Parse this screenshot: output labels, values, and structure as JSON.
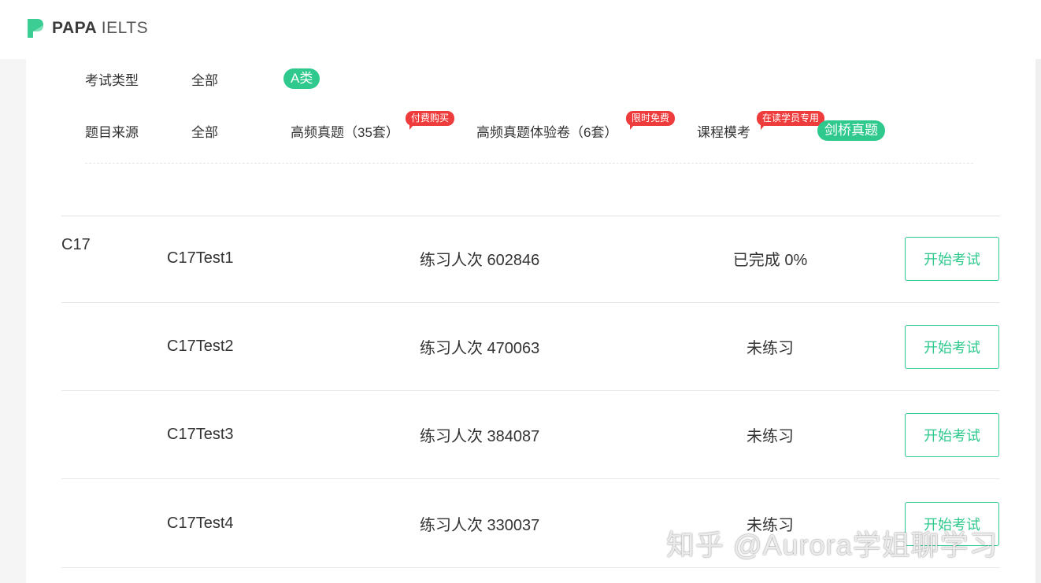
{
  "brand": {
    "name_bold": "PAPA",
    "name_light": "IELTS",
    "accent": "#2fc98e"
  },
  "filters": {
    "exam_type": {
      "label": "考试类型",
      "options": [
        {
          "label": "全部",
          "selected": false
        },
        {
          "label": "A类",
          "selected": true
        }
      ]
    },
    "source": {
      "label": "题目来源",
      "options": [
        {
          "label": "全部",
          "selected": false,
          "badge": ""
        },
        {
          "label": "高频真题（35套）",
          "selected": false,
          "badge": "付费购买"
        },
        {
          "label": "高频真题体验卷（6套）",
          "selected": false,
          "badge": "限时免费"
        },
        {
          "label": "课程模考",
          "selected": false,
          "badge": "在读学员专用"
        },
        {
          "label": "剑桥真题",
          "selected": true,
          "badge": ""
        }
      ]
    }
  },
  "group": {
    "title": "C17",
    "expanded": true
  },
  "tests": [
    {
      "name": "C17Test1",
      "count_text": "练习人次 602846",
      "status": "已完成 0%",
      "action": "开始考试"
    },
    {
      "name": "C17Test2",
      "count_text": "练习人次 470063",
      "status": "未练习",
      "action": "开始考试"
    },
    {
      "name": "C17Test3",
      "count_text": "练习人次 384087",
      "status": "未练习",
      "action": "开始考试"
    },
    {
      "name": "C17Test4",
      "count_text": "练习人次 330037",
      "status": "未练习",
      "action": "开始考试"
    }
  ],
  "watermark": "知乎 @Aurora学姐聊学习"
}
